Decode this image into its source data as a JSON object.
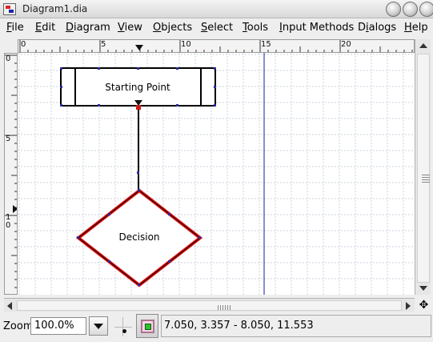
{
  "window": {
    "title": "Diagram1.dia"
  },
  "menu": [
    {
      "label": "File",
      "ul": "F",
      "rest": "ile"
    },
    {
      "label": "Edit",
      "ul": "E",
      "rest": "dit"
    },
    {
      "label": "Diagram",
      "ul": "D",
      "rest": "iagram"
    },
    {
      "label": "View",
      "ul": "V",
      "rest": "iew"
    },
    {
      "label": "Objects",
      "ul": "O",
      "rest": "bjects"
    },
    {
      "label": "Select",
      "ul": "S",
      "rest": "elect"
    },
    {
      "label": "Tools",
      "ul": "T",
      "rest": "ools"
    },
    {
      "label": "Input Methods",
      "ul": "I",
      "rest": "nput Methods"
    },
    {
      "label": "Dialogs",
      "ul": "i",
      "pre": "D",
      "rest": "alogs"
    },
    {
      "label": "Help",
      "ul": "H",
      "rest": "elp"
    }
  ],
  "rulers": {
    "horizontal_labels": [
      "0",
      "5",
      "10",
      "15",
      "20"
    ],
    "vertical_labels": [
      "0",
      "5",
      "1\n0"
    ]
  },
  "canvas": {
    "background": "#ffffff",
    "grid_color": "#c9d3dc",
    "guide_color": "#1a1aa8",
    "shapes": {
      "start": {
        "label": "Starting Point"
      },
      "decision": {
        "label": "Decision",
        "highlight_color": "#e01010"
      }
    }
  },
  "status": {
    "zoom_label": "Zoom",
    "zoom_value": "100.0%",
    "coordinates": "7.050, 3.357 - 8.050, 11.553"
  },
  "icons": {
    "minimize": "minimize-icon",
    "maximize": "maximize-icon",
    "close": "close-icon",
    "navigate": "navigate-cross-icon"
  }
}
